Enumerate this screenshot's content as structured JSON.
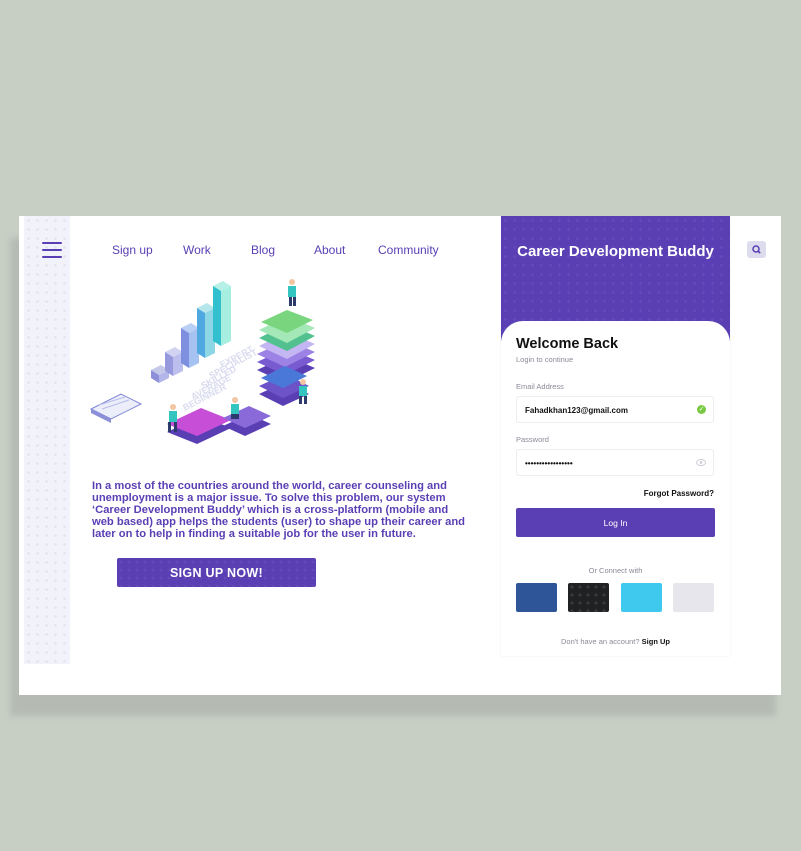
{
  "nav": {
    "menu_icon": "hamburger-icon",
    "items": [
      {
        "label": "Sign up"
      },
      {
        "label": "Work"
      },
      {
        "label": "Blog"
      },
      {
        "label": "About"
      },
      {
        "label": "Community"
      }
    ]
  },
  "hero": {
    "illustration_labels": [
      "EXPERT",
      "SPECIALIST",
      "SKILLED",
      "AVERAGE",
      "BEGINNER"
    ],
    "description": "In a most of the countries around the world, career counseling and unemployment is a major issue. To solve this problem, our system ‘Career Development Buddy’ which is a cross-platform (mobile and web based) app helps the students (user) to shape up their career and later on to help in finding a suitable job for the user in future.",
    "cta_label": "SIGN UP NOW!"
  },
  "login": {
    "app_title": "Career Development Buddy",
    "welcome": "Welcome Back",
    "subtitle": "Login to continue",
    "email_label": "Email Address",
    "email_value": "Fahadkhan123@gmail.com",
    "password_label": "Password",
    "password_value": "•••••••••••••••••",
    "forgot": "Forgot Password?",
    "login_button": "Log In",
    "or_connect": "Or Connect with",
    "no_account": "Don't have an account?",
    "sign_up": "Sign Up"
  },
  "colors": {
    "primary": "#5a3fb4",
    "facebook": "#2e5598",
    "github": "#202122",
    "twitter": "#3fc9ee",
    "apple": "#e6e6ec",
    "success": "#7ac943"
  },
  "icons": {
    "search": "search-icon",
    "email_status": "check-circle-icon",
    "password_toggle": "eye-icon"
  }
}
